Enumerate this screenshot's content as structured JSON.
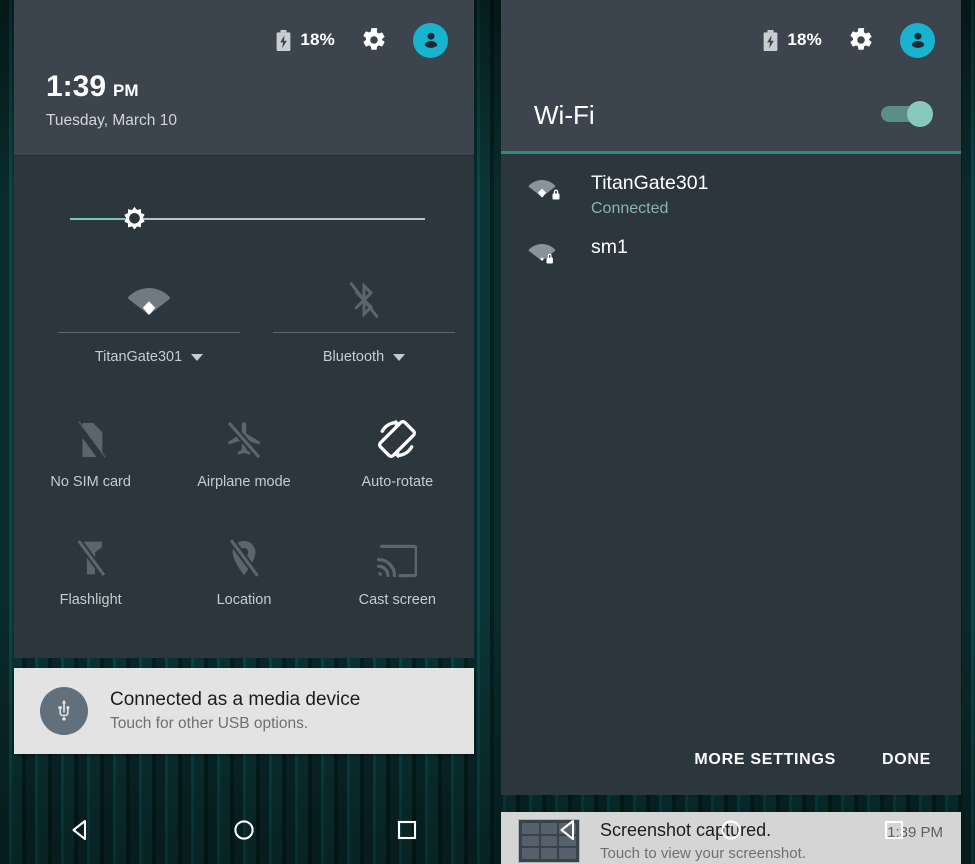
{
  "status": {
    "battery_percent": "18%",
    "battery_icon": "battery-charging-icon",
    "settings_icon": "gear-icon",
    "avatar_icon": "user-avatar-icon",
    "accent_cyan": "#18b4cf"
  },
  "left_panel": {
    "clock": {
      "time": "1:39",
      "ampm": "PM",
      "date": "Tuesday, March 10"
    },
    "brightness": {
      "label": "brightness-slider",
      "fill_percent": 15
    },
    "dual_tiles": [
      {
        "label": "TitanGate301",
        "icon": "wifi-icon",
        "enabled": true
      },
      {
        "label": "Bluetooth",
        "icon": "bluetooth-disabled-icon",
        "enabled": false
      }
    ],
    "tiles": [
      {
        "label": "No SIM card",
        "icon": "sim-card-off-icon",
        "enabled": false
      },
      {
        "label": "Airplane mode",
        "icon": "airplane-off-icon",
        "enabled": false
      },
      {
        "label": "Auto-rotate",
        "icon": "auto-rotate-icon",
        "enabled": true
      },
      {
        "label": "Flashlight",
        "icon": "flashlight-off-icon",
        "enabled": false
      },
      {
        "label": "Location",
        "icon": "location-off-icon",
        "enabled": false
      },
      {
        "label": "Cast screen",
        "icon": "cast-screen-icon",
        "enabled": false
      }
    ],
    "usb_notification": {
      "icon": "usb-icon",
      "title": "Connected as a media device",
      "subtitle": "Touch for other USB options."
    }
  },
  "right_panel": {
    "title": "Wi-Fi",
    "toggle": {
      "icon": "toggle-switch-icon",
      "on": true
    },
    "networks": [
      {
        "ssid": "TitanGate301",
        "state": "Connected",
        "icon": "wifi-lock-strong-icon",
        "signal": 4
      },
      {
        "ssid": "sm1",
        "state": "",
        "icon": "wifi-lock-weak-icon",
        "signal": 2
      }
    ],
    "actions": [
      {
        "label": "MORE SETTINGS"
      },
      {
        "label": "DONE"
      }
    ],
    "toast": {
      "icon": "screenshot-thumbnail",
      "title": "Screenshot captured.",
      "subtitle": "Touch to view your screenshot.",
      "time": "1:39 PM"
    }
  },
  "navbar": {
    "back": "back-triangle-icon",
    "home": "home-circle-icon",
    "recents": "recents-square-icon"
  }
}
